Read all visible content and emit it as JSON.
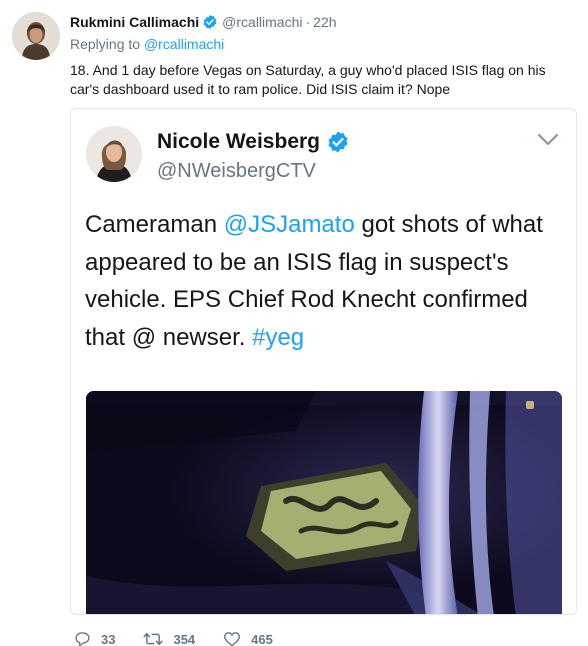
{
  "tweet": {
    "author_name": "Rukmini Callimachi",
    "handle": "@rcallimachi",
    "separator": "·",
    "time": "22h",
    "replying_to_prefix": "Replying to ",
    "replying_to_handle": "@rcallimachi",
    "text": "18. And 1 day before Vegas on Saturday, a guy who'd placed ISIS flag on his car's dashboard used it to ram police. Did ISIS claim it? Nope",
    "actions": {
      "replies": "33",
      "retweets": "354",
      "likes": "465"
    }
  },
  "quoted_tweet": {
    "author_name": "Nicole Weisberg",
    "handle": "@NWeisbergCTV",
    "text_parts": {
      "p1": "Cameraman ",
      "mention": "@JSJamato",
      "p2": " got shots of what appeared to be an ISIS flag in suspect's vehicle. EPS Chief Rod Knecht confirmed that @ newser. ",
      "hashtag": "#yeg"
    }
  },
  "colors": {
    "accent": "#1da1f2",
    "muted": "#657786",
    "text": "#14171a",
    "border": "#e1e8ed"
  },
  "icons": {
    "verified": "verified-badge-icon",
    "reply": "reply-icon",
    "retweet": "retweet-icon",
    "like": "heart-icon",
    "chevron": "chevron-down-icon"
  }
}
